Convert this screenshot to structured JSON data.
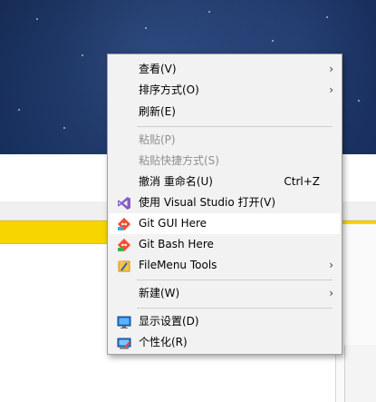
{
  "menu": {
    "items": [
      {
        "label": "查看(V)",
        "submenu": true
      },
      {
        "label": "排序方式(O)",
        "submenu": true
      },
      {
        "label": "刷新(E)"
      },
      {
        "label": "粘贴(P)",
        "disabled": true
      },
      {
        "label": "粘贴快捷方式(S)",
        "disabled": true
      },
      {
        "label": "撤消 重命名(U)",
        "shortcut": "Ctrl+Z"
      },
      {
        "label": "使用 Visual Studio 打开(V)",
        "icon": "visual-studio-icon"
      },
      {
        "label": "Git GUI Here",
        "icon": "git-gui-icon",
        "highlighted": true
      },
      {
        "label": "Git Bash Here",
        "icon": "git-bash-icon"
      },
      {
        "label": "FileMenu Tools",
        "icon": "filemenu-tools-icon",
        "submenu": true
      },
      {
        "label": "新建(W)",
        "submenu": true
      },
      {
        "label": "显示设置(D)",
        "icon": "display-settings-icon"
      },
      {
        "label": "个性化(R)",
        "icon": "personalize-icon"
      }
    ],
    "submenu_glyph": "›"
  },
  "colors": {
    "menu_bg": "#f2f2f2",
    "highlight_bg": "#ffffff",
    "disabled_text": "#8f8f8f",
    "yellow_bar": "#f7d500",
    "visual_studio": "#865fc5",
    "git": "#f05133"
  }
}
